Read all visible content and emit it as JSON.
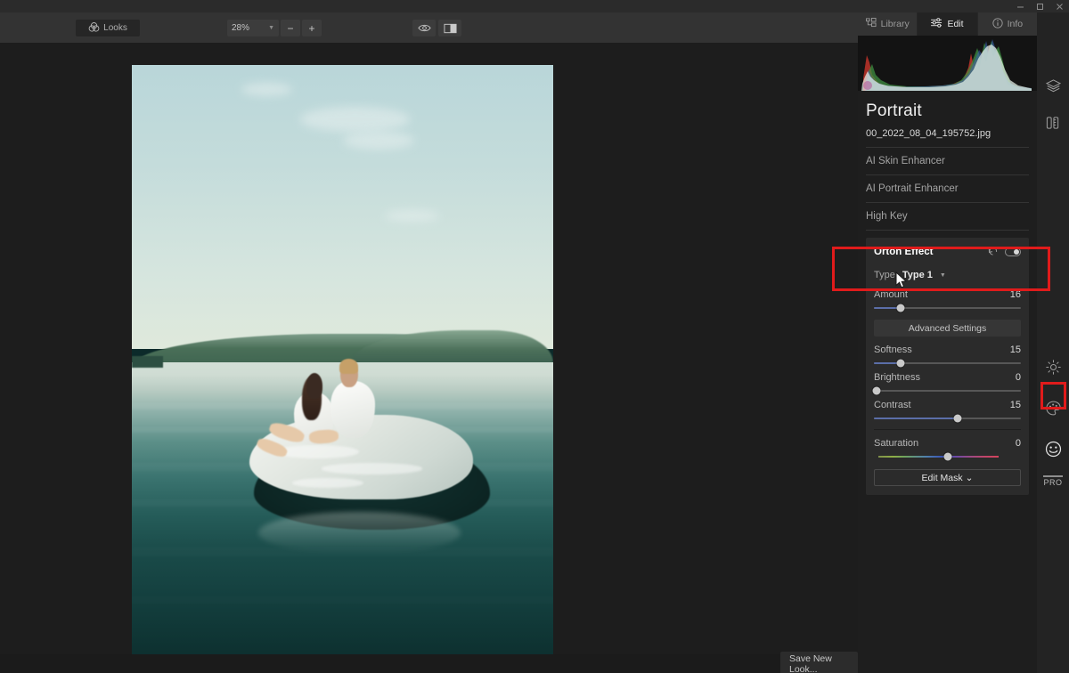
{
  "window": {
    "controls": [
      {
        "name": "minimize",
        "glyph": "minimize-icon"
      },
      {
        "name": "maximize",
        "glyph": "maximize-icon"
      },
      {
        "name": "close",
        "glyph": "close-icon"
      }
    ]
  },
  "toolbar": {
    "looks_label": "Looks",
    "looks_icon": "venn-circles-icon",
    "zoom_value": "28%",
    "zoom_out_label": "−",
    "zoom_in_label": "+",
    "preview_icon": "eye-icon",
    "compare_icon": "before-after-icon"
  },
  "panel": {
    "tabs": [
      {
        "label": "Library",
        "icon": "library-icon",
        "active": false
      },
      {
        "label": "Edit",
        "icon": "sliders-icon",
        "active": true
      },
      {
        "label": "Info",
        "icon": "info-icon",
        "active": false
      }
    ],
    "histogram_label": "rgb-histogram",
    "photo_title": "Portrait",
    "filename": "00_2022_08_04_195752.jpg",
    "filters": [
      {
        "label": "AI Skin Enhancer"
      },
      {
        "label": "AI Portrait Enhancer"
      },
      {
        "label": "High Key"
      }
    ],
    "effect": {
      "title": "Orton Effect",
      "reset_icon": "reset-icon",
      "toggle_icon": "toggle-on-icon",
      "type_label": "Type",
      "type_value": "Type 1",
      "amount": {
        "label": "Amount",
        "value": "16",
        "percent": 18
      },
      "advanced_label": "Advanced Settings",
      "sliders": [
        {
          "label": "Softness",
          "value": "15",
          "percent": 18,
          "style": "blue"
        },
        {
          "label": "Brightness",
          "value": "0",
          "percent": 2,
          "style": "white"
        },
        {
          "label": "Contrast",
          "value": "15",
          "percent": 57,
          "style": "blue"
        },
        {
          "label": "Saturation",
          "value": "0",
          "percent": 50,
          "style": "rainbow"
        }
      ],
      "mask_label": "Edit Mask",
      "mask_caret": "⌄"
    }
  },
  "rail": {
    "icons": [
      {
        "name": "layers-icon"
      },
      {
        "name": "crop-tools-icon"
      },
      {
        "name": "brightness-icon"
      },
      {
        "name": "color-palette-icon"
      },
      {
        "name": "portrait-face-icon"
      }
    ],
    "pro_label": "PRO"
  },
  "bottom": {
    "save_look_label": "Save New Look..."
  },
  "annotations": {
    "highlight_color": "#e01b1b",
    "boxes": [
      {
        "name": "amount-slider-highlight"
      },
      {
        "name": "portrait-tool-highlight"
      }
    ]
  },
  "image": {
    "alt_name": "couple-on-bed-floating-on-lake"
  }
}
